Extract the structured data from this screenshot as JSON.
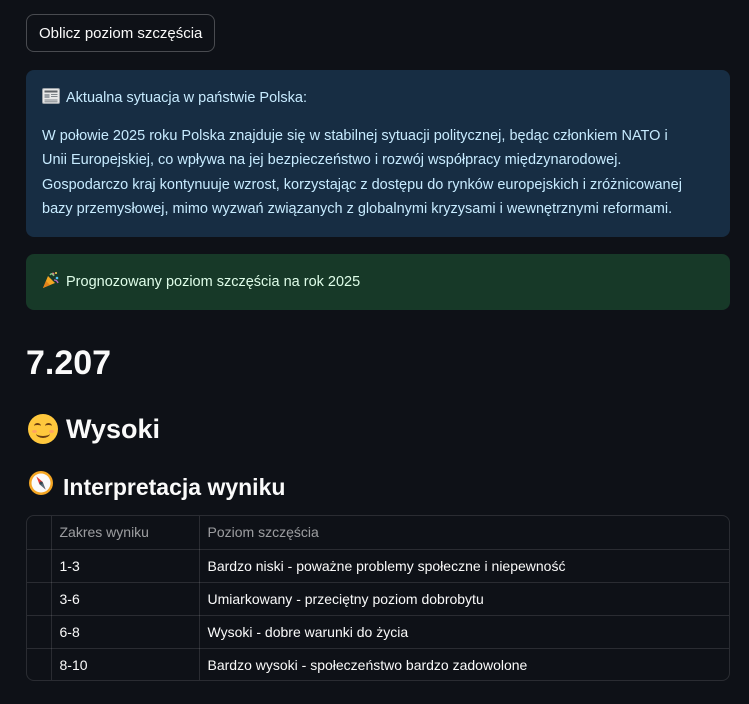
{
  "button": {
    "label": "Oblicz poziom szczęścia"
  },
  "info_box": {
    "icon": "newspaper-icon",
    "heading": "Aktualna sytuacja w państwie Polska:",
    "lines": [
      "W połowie 2025 roku Polska znajduje się w stabilnej sytuacji politycznej, będąc członkiem NATO i",
      "Unii Europejskiej, co wpływa na jej bezpieczeństwo i rozwój współpracy międzynarodowej.",
      "Gospodarczo kraj kontynuuje wzrost, korzystając z dostępu do rynków europejskich i zróżnicowanej",
      "bazy przemysłowej, mimo wyzwań związanych z globalnymi kryzysami i wewnętrznymi reformami."
    ]
  },
  "success_box": {
    "icon": "party-popper-icon",
    "text": "Prognozowany poziom szczęścia na rok 2025"
  },
  "score": "7.207",
  "level": {
    "icon": "smiling-face-icon",
    "label": "Wysoki"
  },
  "interpretation": {
    "icon": "compass-icon",
    "heading": "Interpretacja wyniku",
    "columns": [
      "Zakres wyniku",
      "Poziom szczęścia"
    ],
    "rows": [
      {
        "range": "1-3",
        "level": "Bardzo niski - poważne problemy społeczne i niepewność"
      },
      {
        "range": "3-6",
        "level": "Umiarkowany - przeciętny poziom dobrobytu"
      },
      {
        "range": "6-8",
        "level": "Wysoki - dobre warunki do życia"
      },
      {
        "range": "8-10",
        "level": "Bardzo wysoki - społeczeństwo bardzo zadowolone"
      }
    ]
  },
  "colors": {
    "background": "#0e1117",
    "info_bg": "#172d43",
    "info_text": "#c7ebff",
    "success_bg": "#173928",
    "success_text": "#dffde9"
  }
}
